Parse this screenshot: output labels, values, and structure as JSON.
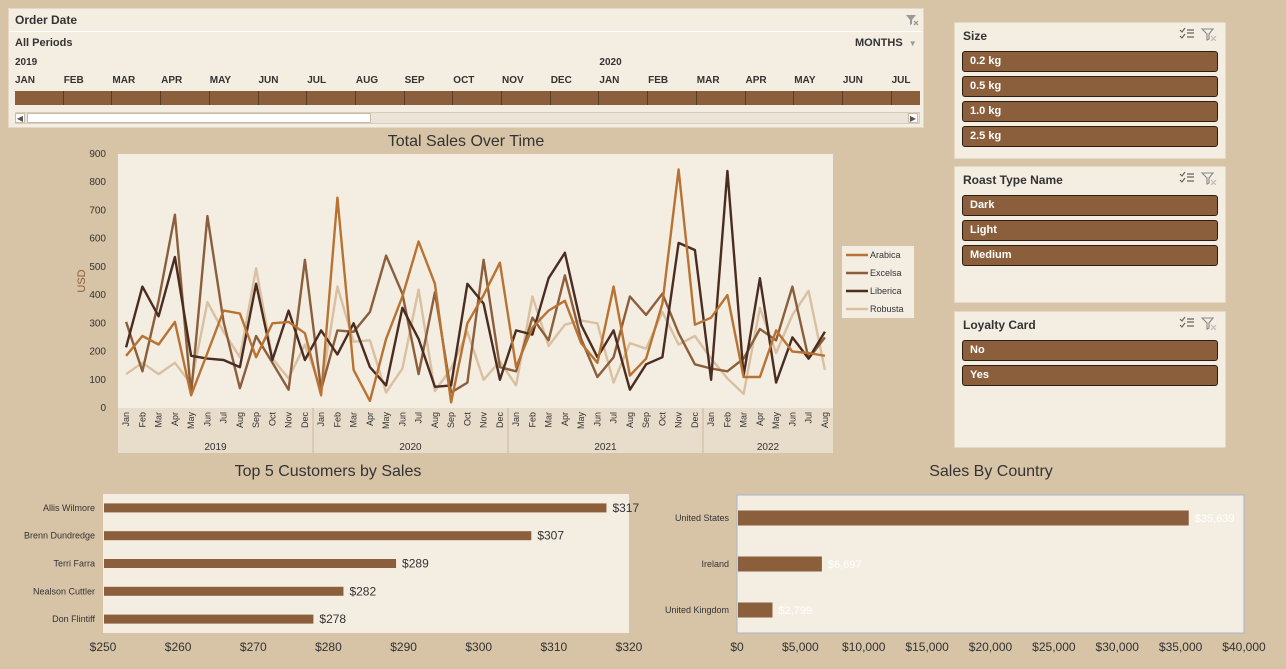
{
  "timeline": {
    "title": "Order Date",
    "periods_label": "All Periods",
    "granularity": "MONTHS",
    "years": [
      {
        "label": "2019",
        "month_index": 0
      },
      {
        "label": "2020",
        "month_index": 12
      }
    ],
    "months": [
      "JAN",
      "FEB",
      "MAR",
      "APR",
      "MAY",
      "JUN",
      "JUL",
      "AUG",
      "SEP",
      "OCT",
      "NOV",
      "DEC",
      "JAN",
      "FEB",
      "MAR",
      "APR",
      "MAY",
      "JUN",
      "JUL"
    ],
    "icons": {
      "clear_filter": "clear-filter-icon",
      "dropdown": "chevron-down-icon",
      "left": "scroll-left-icon",
      "right": "scroll-right-icon"
    }
  },
  "slicers": [
    {
      "title": "Size",
      "items": [
        "0.2 kg",
        "0.5 kg",
        "1.0 kg",
        "2.5 kg"
      ]
    },
    {
      "title": "Roast Type Name",
      "items": [
        "Dark",
        "Light",
        "Medium"
      ]
    },
    {
      "title": "Loyalty Card",
      "items": [
        "No",
        "Yes"
      ]
    }
  ],
  "colors": {
    "arabica": "#b87333",
    "excelsa": "#8b5e3c",
    "liberica": "#4a2c20",
    "robusta": "#d9c0a0",
    "bar": "#8b5e3c",
    "panel": "#f4ede2",
    "background": "#d7c3a6"
  },
  "chart_data": [
    {
      "type": "line",
      "title": "Total Sales Over Time",
      "ylabel": "USD",
      "ylim": [
        0,
        900
      ],
      "yticks": [
        0,
        100,
        200,
        300,
        400,
        500,
        600,
        700,
        800,
        900
      ],
      "x": [
        "Jan",
        "Feb",
        "Mar",
        "Apr",
        "May",
        "Jun",
        "Jul",
        "Aug",
        "Sep",
        "Oct",
        "Nov",
        "Dec",
        "Jan",
        "Feb",
        "Mar",
        "Apr",
        "May",
        "Jun",
        "Jul",
        "Aug",
        "Sep",
        "Oct",
        "Nov",
        "Dec",
        "Jan",
        "Feb",
        "Mar",
        "Apr",
        "May",
        "Jun",
        "Jul",
        "Aug",
        "Sep",
        "Oct",
        "Nov",
        "Dec",
        "Jan",
        "Feb",
        "Mar",
        "Apr",
        "May",
        "Jun",
        "Jul",
        "Aug"
      ],
      "years": [
        "2019",
        "2020",
        "2021",
        "2022"
      ],
      "legend_position": "right",
      "series": [
        {
          "name": "Arabica",
          "values": [
            185,
            255,
            225,
            305,
            45,
            195,
            345,
            335,
            180,
            300,
            305,
            265,
            45,
            745,
            135,
            25,
            245,
            395,
            590,
            440,
            20,
            300,
            400,
            515,
            145,
            285,
            345,
            380,
            230,
            160,
            430,
            115,
            175,
            370,
            845,
            295,
            320,
            400,
            110,
            110,
            275,
            200,
            195,
            185,
            120
          ]
        },
        {
          "name": "Excelsa",
          "values": [
            305,
            130,
            380,
            685,
            50,
            680,
            305,
            70,
            255,
            160,
            65,
            525,
            65,
            275,
            270,
            340,
            540,
            405,
            120,
            410,
            55,
            90,
            525,
            145,
            130,
            320,
            240,
            470,
            245,
            110,
            180,
            395,
            330,
            405,
            265,
            155,
            140,
            130,
            175,
            280,
            240,
            430,
            175,
            250,
            40
          ]
        },
        {
          "name": "Liberica",
          "values": [
            215,
            430,
            325,
            535,
            185,
            175,
            170,
            145,
            440,
            170,
            345,
            170,
            275,
            190,
            300,
            145,
            80,
            355,
            245,
            75,
            80,
            440,
            370,
            100,
            275,
            260,
            460,
            550,
            295,
            180,
            275,
            65,
            155,
            180,
            585,
            560,
            100,
            840,
            115,
            460,
            90,
            250,
            175,
            270,
            15
          ]
        },
        {
          "name": "Robusta",
          "values": [
            120,
            160,
            120,
            160,
            85,
            375,
            270,
            180,
            495,
            175,
            105,
            225,
            65,
            430,
            235,
            240,
            55,
            140,
            420,
            60,
            140,
            270,
            100,
            165,
            80,
            395,
            220,
            295,
            310,
            300,
            90,
            230,
            210,
            340,
            225,
            255,
            175,
            105,
            50,
            355,
            195,
            330,
            415,
            135,
            70
          ]
        }
      ]
    },
    {
      "type": "bar",
      "title": "Top 5 Customers by Sales",
      "orientation": "horizontal",
      "categories": [
        "Allis Wilmore",
        "Brenn Dundredge",
        "Terri Farra",
        "Nealson Cuttler",
        "Don Flintiff"
      ],
      "values": [
        317,
        307,
        289,
        282,
        278
      ],
      "data_labels": [
        "$317",
        "$307",
        "$289",
        "$282",
        "$278"
      ],
      "xlim": [
        250,
        320
      ],
      "xticks": [
        "$250",
        "$260",
        "$270",
        "$280",
        "$290",
        "$300",
        "$310",
        "$320"
      ]
    },
    {
      "type": "bar",
      "title": "Sales By Country",
      "orientation": "horizontal",
      "categories": [
        "United States",
        "Ireland",
        "United Kingdom"
      ],
      "values": [
        35639,
        6697,
        2799
      ],
      "data_labels": [
        "$35,639",
        "$6,697",
        "$2,799"
      ],
      "xlim": [
        0,
        40000
      ],
      "xticks": [
        "$0",
        "$5,000",
        "$10,000",
        "$15,000",
        "$20,000",
        "$25,000",
        "$30,000",
        "$35,000",
        "$40,000"
      ]
    }
  ]
}
